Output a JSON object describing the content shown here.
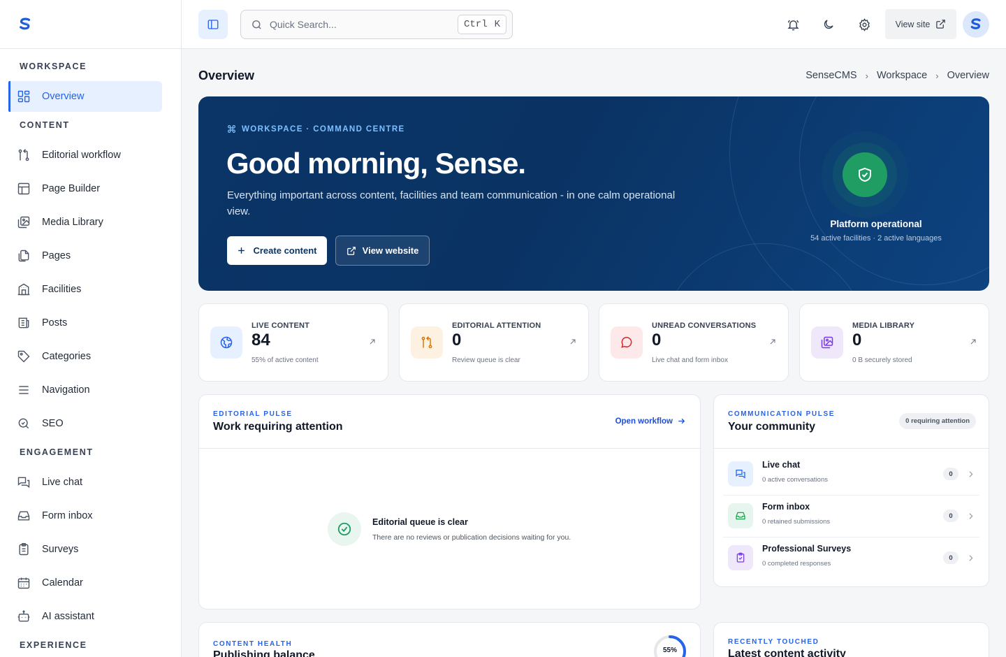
{
  "sidebar": {
    "sections": {
      "workspace": "WORKSPACE",
      "content": "CONTENT",
      "engagement": "ENGAGEMENT",
      "experience": "EXPERIENCE"
    },
    "items": {
      "overview": "Overview",
      "editorial": "Editorial workflow",
      "page_builder": "Page Builder",
      "media": "Media Library",
      "pages": "Pages",
      "facilities": "Facilities",
      "posts": "Posts",
      "categories": "Categories",
      "navigation": "Navigation",
      "seo": "SEO",
      "live_chat": "Live chat",
      "form_inbox": "Form inbox",
      "surveys": "Surveys",
      "calendar": "Calendar",
      "ai": "AI assistant"
    }
  },
  "topbar": {
    "search_placeholder": "Quick Search...",
    "shortcut_ctrl": "Ctrl",
    "shortcut_key": "K",
    "view_site": "View site"
  },
  "page": {
    "title": "Overview",
    "breadcrumb": [
      "SenseCMS",
      "Workspace",
      "Overview"
    ]
  },
  "hero": {
    "eyebrow": "WORKSPACE · COMMAND CENTRE",
    "greeting": "Good morning, Sense.",
    "description": "Everything important across content, facilities and team communication - in one calm operational view.",
    "create_label": "Create content",
    "view_label": "View website",
    "status_title": "Platform operational",
    "status_sub": "54 active facilities · 2 active languages"
  },
  "stats": [
    {
      "label": "LIVE CONTENT",
      "value": "84",
      "sub": "55% of active content"
    },
    {
      "label": "EDITORIAL ATTENTION",
      "value": "0",
      "sub": "Review queue is clear"
    },
    {
      "label": "UNREAD CONVERSATIONS",
      "value": "0",
      "sub": "Live chat and form inbox"
    },
    {
      "label": "MEDIA LIBRARY",
      "value": "0",
      "sub": "0 B securely stored"
    }
  ],
  "editorial": {
    "eyebrow": "EDITORIAL PULSE",
    "title": "Work requiring attention",
    "open_label": "Open workflow",
    "empty_title": "Editorial queue is clear",
    "empty_sub": "There are no reviews or publication decisions waiting for you."
  },
  "community": {
    "eyebrow": "COMMUNICATION PULSE",
    "title": "Your community",
    "badge": "0 requiring attention",
    "rows": [
      {
        "name": "Live chat",
        "sub": "0 active conversations",
        "count": "0"
      },
      {
        "name": "Form inbox",
        "sub": "0 retained submissions",
        "count": "0"
      },
      {
        "name": "Professional Surveys",
        "sub": "0 completed responses",
        "count": "0"
      }
    ]
  },
  "health": {
    "eyebrow": "CONTENT HEALTH",
    "title": "Publishing balance",
    "percent_label": "55%",
    "percent": 0.55
  },
  "recent": {
    "eyebrow": "RECENTLY TOUCHED",
    "title": "Latest content activity"
  }
}
